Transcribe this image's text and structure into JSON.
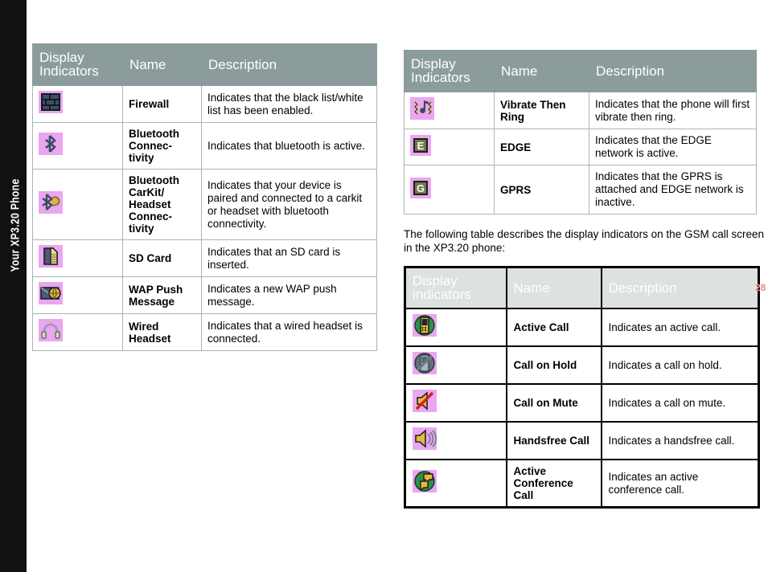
{
  "sidebar": {
    "label": "Your XP3.20 Phone"
  },
  "page_number": "28",
  "colors": {
    "sidebar_bg": "#111111",
    "header_teal": "#8c9c9c",
    "header_gray": "#dde1e1",
    "icon_tile_bg": "#eaa6f0",
    "grid_line": "#a9b5b5",
    "page_number": "#f08a8a"
  },
  "tables": {
    "left": {
      "headers": {
        "indicators_line1": "Display",
        "indicators_line2": "Indicators",
        "name": "Name",
        "description": "Description"
      },
      "rows": [
        {
          "icon": "firewall-icon",
          "name": "Firewall",
          "description": "Indicates that the black list/white list has been enabled."
        },
        {
          "icon": "bluetooth-icon",
          "name": "Bluetooth Connec-\ntivity",
          "description": "Indicates that bluetooth is active."
        },
        {
          "icon": "bluetooth-carkit-headset-icon",
          "name": "Bluetooth CarKit/ Headset Connec-\ntivity",
          "description": "Indicates that your device is paired and connected to a carkit or headset with bluetooth connectivity."
        },
        {
          "icon": "sd-card-icon",
          "name": "SD Card",
          "description": "Indicates that an SD card is inserted."
        },
        {
          "icon": "wap-push-message-icon",
          "name": "WAP Push Message",
          "description": "Indicates a new WAP push message."
        },
        {
          "icon": "wired-headset-icon",
          "name": "Wired Headset",
          "description": "Indicates that a wired headset is connected."
        }
      ]
    },
    "right_top": {
      "headers": {
        "indicators_line1": "Display",
        "indicators_line2": "Indicators",
        "name": "Name",
        "description": "Description"
      },
      "rows": [
        {
          "icon": "vibrate-then-ring-icon",
          "name": "Vibrate Then Ring",
          "description": "Indicates that the phone will first vibrate then ring."
        },
        {
          "icon": "edge-icon",
          "name": "EDGE",
          "description": "Indicates that the EDGE network is active."
        },
        {
          "icon": "gprs-icon",
          "name": "GPRS",
          "description": "Indicates that the GPRS is attached and EDGE network is inactive."
        }
      ]
    },
    "right_bottom": {
      "headers": {
        "indicators_line1": "Display",
        "indicators_line2": "indicators",
        "name": "Name",
        "description": "Description"
      },
      "rows": [
        {
          "icon": "active-call-icon",
          "name": "Active Call",
          "description": "Indicates an active call."
        },
        {
          "icon": "call-on-hold-icon",
          "name": "Call on Hold",
          "description": "Indicates a call on hold."
        },
        {
          "icon": "call-on-mute-icon",
          "name": "Call on Mute",
          "description": "Indicates a call on mute."
        },
        {
          "icon": "handsfree-call-icon",
          "name": "Handsfree Call",
          "description": "Indicates a handsfree call."
        },
        {
          "icon": "active-conference-call-icon",
          "name": "Active Conference Call",
          "description": "Indicates an active conference call."
        }
      ]
    }
  },
  "paragraph": "The following table describes the display indicators on the GSM call screen in the XP3.20 phone:"
}
